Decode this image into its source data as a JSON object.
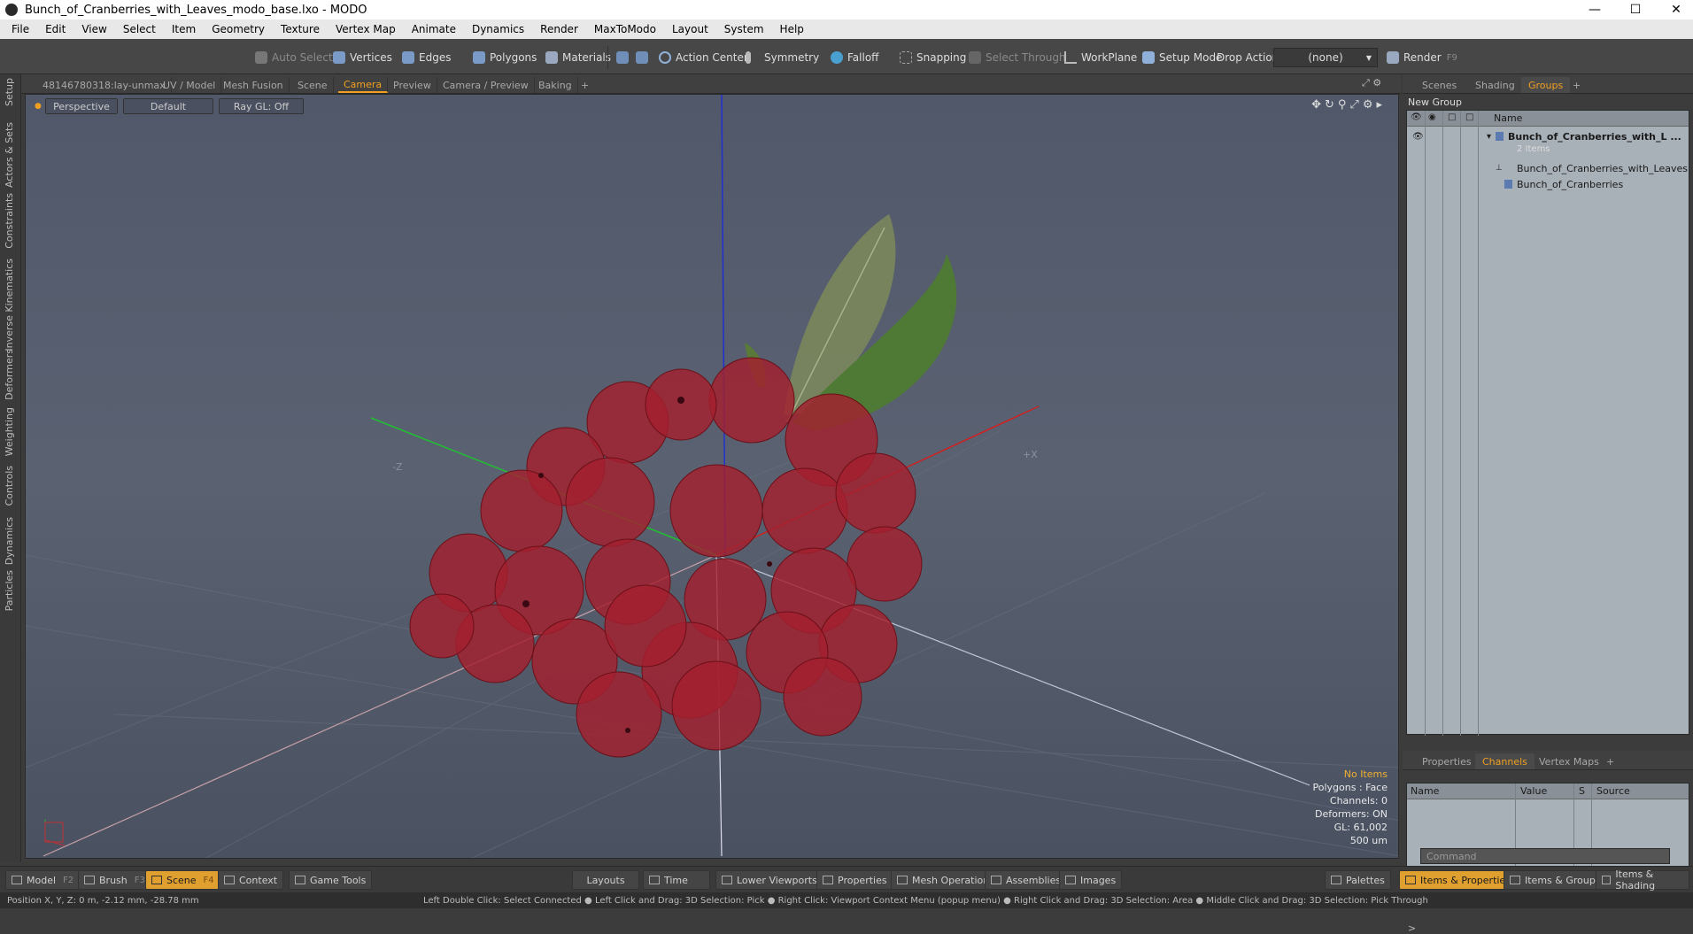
{
  "window": {
    "title": "Bunch_of_Cranberries_with_Leaves_modo_base.lxo - MODO"
  },
  "menu": [
    "File",
    "Edit",
    "View",
    "Select",
    "Item",
    "Geometry",
    "Texture",
    "Vertex Map",
    "Animate",
    "Dynamics",
    "Render",
    "MaxToModo",
    "Layout",
    "System",
    "Help"
  ],
  "toolbar": {
    "auto_select": "Auto Select",
    "vertices": "Vertices",
    "edges": "Edges",
    "polygons": "Polygons",
    "materials": "Materials",
    "action_center": "Action Center",
    "symmetry": "Symmetry",
    "falloff": "Falloff",
    "snapping": "Snapping",
    "select_through": "Select Through",
    "workplane": "WorkPlane",
    "setup_mode": "Setup Mode",
    "drop_action": "Drop Action",
    "drop_value": "(none)",
    "render": "Render",
    "render_key": "F9"
  },
  "left_tabs": [
    "Setup",
    "Actors & Sets",
    "Constraints",
    "Inverse Kinematics",
    "Deformers",
    "Weighting",
    "Controls",
    "Dynamics",
    "Particles"
  ],
  "viewport_tabs": [
    "48146780318:lay-unmax",
    "UV / Model",
    "Mesh Fusion",
    "Scene",
    "Camera",
    "Preview",
    "Camera / Preview",
    "Baking",
    "+"
  ],
  "viewport": {
    "perspective": "Perspective",
    "default": "Default",
    "raygl": "Ray GL: Off",
    "axis_z": "-Z",
    "axis_x": "+X",
    "hud": {
      "no_items": "No Items",
      "polygons": "Polygons : Face",
      "channels": "Channels: 0",
      "deformers": "Deformers: ON",
      "gl": "GL: 61,002",
      "scale": "500 um"
    }
  },
  "right_tabs": [
    "Scenes",
    "Shading",
    "Groups",
    "+"
  ],
  "groups": {
    "new_group": "New Group",
    "name_col": "Name",
    "root": "Bunch_of_Cranberries_with_L ...",
    "root_sub": "2 Items",
    "child1": "Bunch_of_Cranberries_with_Leaves",
    "child2": "Bunch_of_Cranberries"
  },
  "props_tabs": [
    "Properties",
    "Channels",
    "Vertex Maps",
    "+"
  ],
  "channels": {
    "name": "Name",
    "value": "Value",
    "s": "S",
    "source": "Source"
  },
  "command": {
    "placeholder": "Command"
  },
  "bottom": {
    "model": "Model",
    "model_key": "F2",
    "brush": "Brush",
    "brush_key": "F3",
    "scene": "Scene",
    "scene_key": "F4",
    "context": "Context",
    "game_tools": "Game Tools",
    "layouts": "Layouts",
    "time": "Time",
    "lower_viewports": "Lower Viewports",
    "properties": "Properties",
    "mesh_ops": "Mesh Operations",
    "assemblies": "Assemblies",
    "images": "Images",
    "palettes": "Palettes",
    "items_props": "Items & Properties",
    "items_groups": "Items & Groups",
    "items_shading": "Items & Shading"
  },
  "status": {
    "position": "Position X, Y, Z:  0 m, -2.12 mm, -28.78 mm",
    "hint": "Left Double Click: Select Connected ● Left Click and Drag: 3D Selection: Pick ● Right Click: Viewport Context Menu (popup menu) ● Right Click and Drag: 3D Selection: Area ● Middle Click and Drag: 3D Selection: Pick Through"
  },
  "colors": {
    "accent": "#f0a020",
    "berry": "#a3202e",
    "leaf": "#4f7a35"
  }
}
